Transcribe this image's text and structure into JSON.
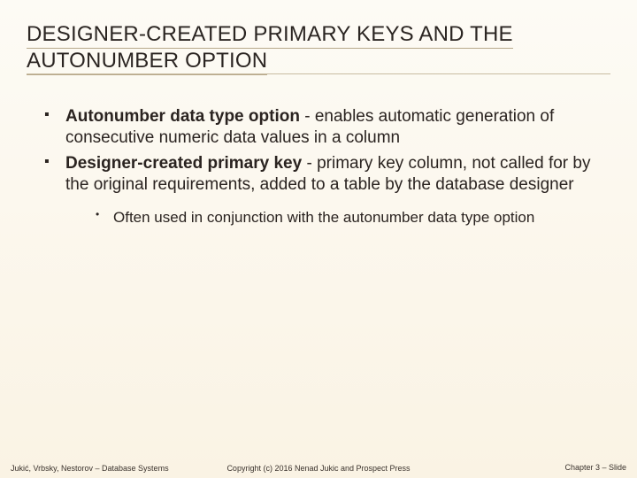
{
  "title": "DESIGNER-CREATED PRIMARY KEYS AND THE AUTONUMBER OPTION",
  "bullets": [
    {
      "bold": "Autonumber data type option",
      "rest": " - enables automatic generation of consecutive numeric data values in a column"
    },
    {
      "bold": "Designer-created primary key",
      "rest": " - primary key column, not called for by the original requirements, added to a table by the database designer"
    }
  ],
  "sub_bullet": "Often used in conjunction with the autonumber data type option",
  "footer": {
    "left": "Jukić, Vrbsky, Nestorov – Database Systems",
    "center": "Copyright (c) 2016 Nenad Jukic and Prospect Press",
    "right": "Chapter 3 – Slide"
  }
}
